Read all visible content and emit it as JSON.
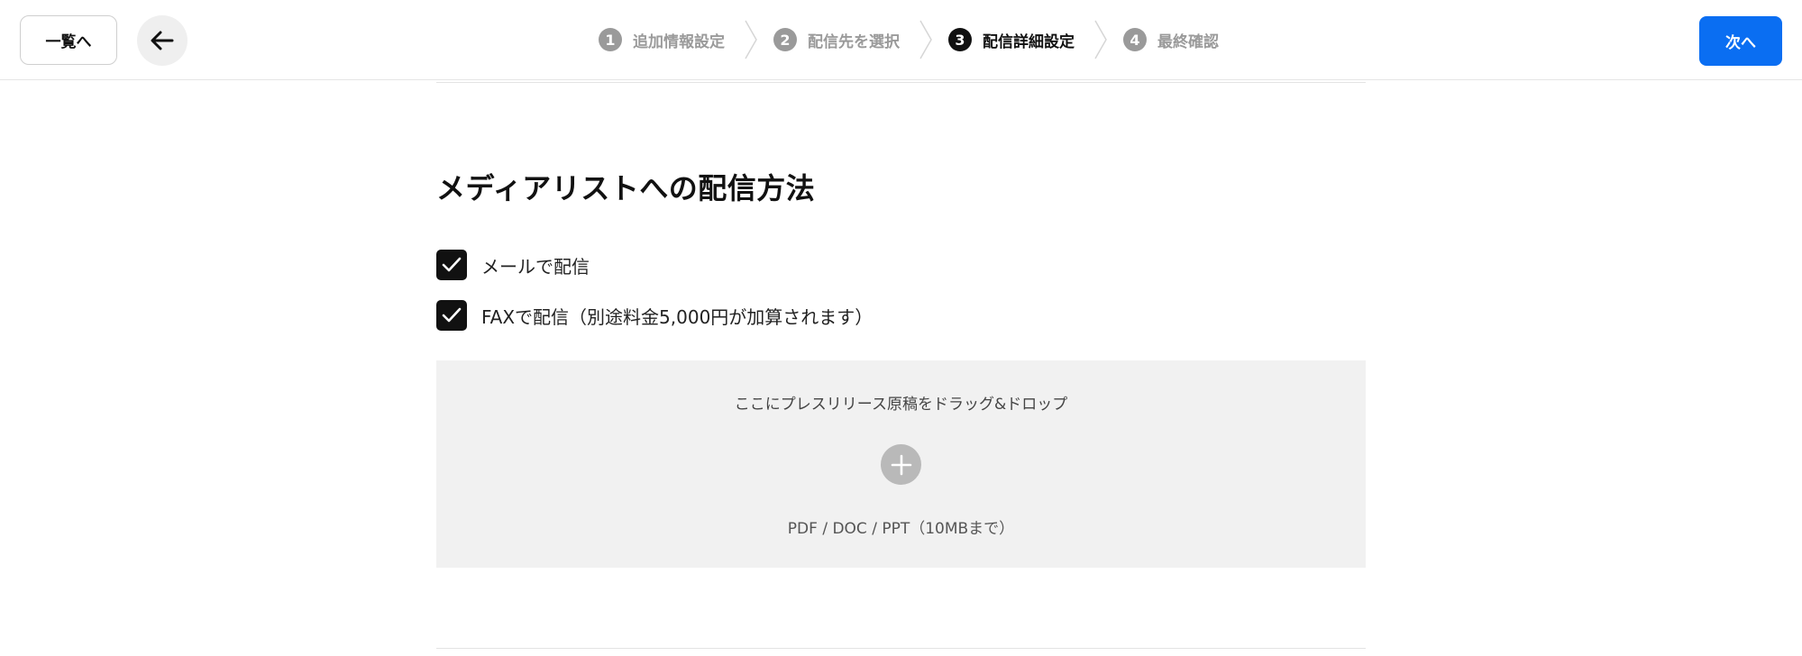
{
  "header": {
    "list_button": "一覧へ",
    "back_icon": "arrow-left-icon",
    "next_button": "次へ",
    "steps": [
      {
        "num": "1",
        "label": "追加情報設定",
        "state": "inactive"
      },
      {
        "num": "2",
        "label": "配信先を選択",
        "state": "inactive"
      },
      {
        "num": "3",
        "label": "配信詳細設定",
        "state": "active"
      },
      {
        "num": "4",
        "label": "最終確認",
        "state": "inactive"
      }
    ]
  },
  "section": {
    "title": "メディアリストへの配信方法",
    "options": [
      {
        "label": "メールで配信",
        "checked": true
      },
      {
        "label": "FAXで配信（別途料金5,000円が加算されます）",
        "checked": true
      }
    ]
  },
  "dropzone": {
    "instruction": "ここにプレスリリース原稿をドラッグ&ドロップ",
    "icon": "plus-icon",
    "formats": "PDF / DOC / PPT（10MBまで）"
  },
  "colors": {
    "accent": "#0a6ef2",
    "step_active": "#111111",
    "step_inactive": "#9a9a9a",
    "dropzone_bg": "#f1f1f1"
  }
}
